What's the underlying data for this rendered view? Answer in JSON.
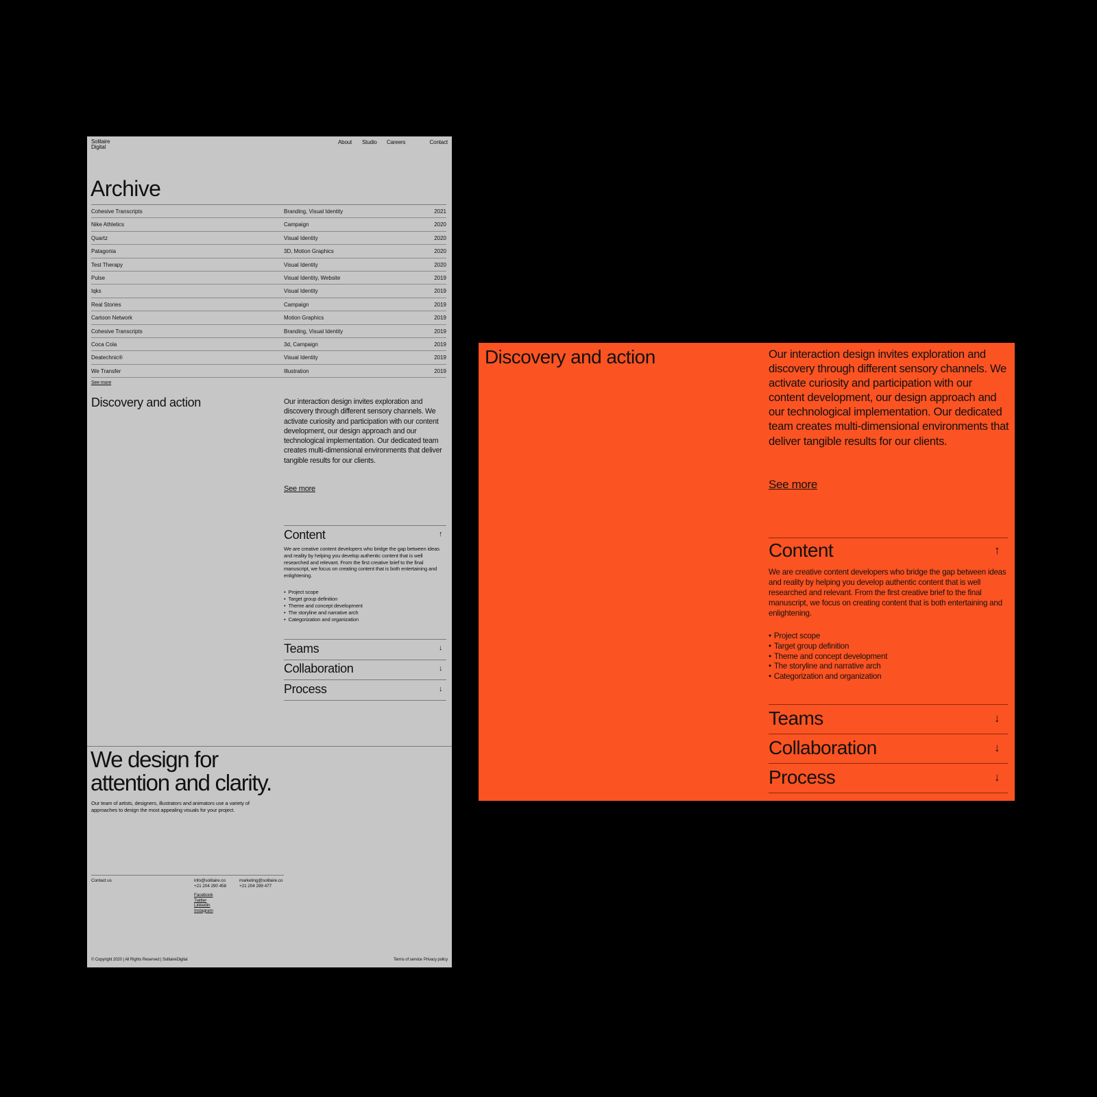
{
  "brand": {
    "line1": "Solitaire",
    "line2": "Digital"
  },
  "nav": [
    "About",
    "Studio",
    "Careers",
    "Contact"
  ],
  "archive": {
    "title": "Archive",
    "rows": [
      [
        "Cohesive Transcripts",
        "Branding, Visual Identity",
        "2021"
      ],
      [
        "Nike Athletics",
        "Campaign",
        "2020"
      ],
      [
        "Quartz",
        "Visual Identity",
        "2020"
      ],
      [
        "Patagonia",
        "3D, Motion Graphics",
        "2020"
      ],
      [
        "Test Therapy",
        "Visual Identity",
        "2020"
      ],
      [
        "Pulse",
        "Visual Identity, Website",
        "2019"
      ],
      [
        "Iqks",
        "Visual Identity",
        "2019"
      ],
      [
        "Real Stories",
        "Campaign",
        "2019"
      ],
      [
        "Cartoon Network",
        "Motion Graphics",
        "2019"
      ],
      [
        "Cohesive Transcripts",
        "Branding, Visual Identity",
        "2019"
      ],
      [
        "Coca Cola",
        "3d, Campaign",
        "2019"
      ],
      [
        "Deatechnic®",
        "Visual Identity",
        "2019"
      ],
      [
        "We Transfer",
        "Illustration",
        "2019"
      ]
    ],
    "see_more": "See more"
  },
  "discovery": {
    "title": "Discovery and action",
    "body": "Our interaction design invites exploration and discovery through different sensory channels. We activate curiosity and participation with our content development, our design approach and our technological implementation. Our dedicated team creates multi-dimensional environments that deliver tangible results for our clients.",
    "see_more": "See more"
  },
  "accordion": {
    "content": {
      "title": "Content",
      "icon": "arrow-up-icon",
      "body": "We are creative content developers who bridge the gap between ideas and reality by helping you develop authentic content that is well researched and relevant. From the first creative brief to the final manuscript, we focus on creating content that is both entertaining and enlightening.",
      "bullets": [
        "Project scope",
        "Target group definition",
        "Theme and concept development",
        "The storyline and narrative arch",
        "Categorization and organization"
      ]
    },
    "collapsed": [
      {
        "title": "Teams",
        "icon": "arrow-down-icon"
      },
      {
        "title": "Collaboration",
        "icon": "arrow-down-icon"
      },
      {
        "title": "Process",
        "icon": "arrow-down-icon"
      }
    ]
  },
  "hero": {
    "line1": "We design for",
    "line2": "attention and clarity.",
    "body": "Our team of artists, designers, illustrators and animators use a variety of approaches to design the most appealing visuals for your project."
  },
  "contact": {
    "label": "Contact us",
    "email1": "info@solitaire.co",
    "phone1": "+21 204 290 458",
    "email2": "marketing@solitaire.co",
    "phone2": "+21 204 299 477",
    "socials": [
      "Facebook",
      "Twitter",
      "LinkedIn",
      "Instagram"
    ]
  },
  "footer": {
    "copyright": "© Copyright 2020 | All Rights Reserved | SolitaireDigital",
    "terms": "Terms of service",
    "privacy": "Privacy policy"
  },
  "colors": {
    "panel_grey": "#c6c6c6",
    "accent_orange": "#fc5322",
    "background": "#000000"
  }
}
